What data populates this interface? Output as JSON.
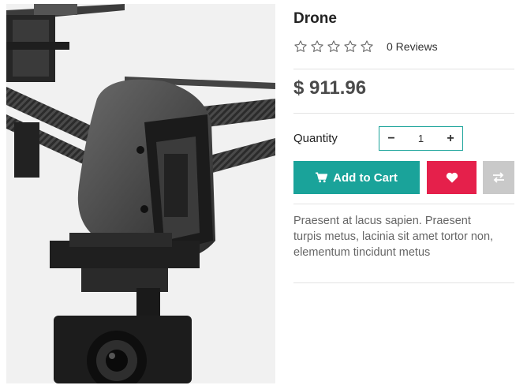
{
  "product": {
    "title": "Drone",
    "image_alt": "drone-image",
    "rating": {
      "stars_filled": 0,
      "stars_total": 5
    },
    "reviews_label": "0 Reviews",
    "price": "$ 911.96",
    "quantity_label": "Quantity",
    "quantity_value": "1",
    "minus_label": "−",
    "plus_label": "+",
    "add_to_cart_label": "Add to Cart",
    "description": "Praesent at lacus sapien. Praesent turpis metus, lacinia sit amet tortor non, elementum tincidunt metus"
  },
  "colors": {
    "accent": "#1aa39a",
    "wishlist": "#e5204b",
    "compare": "#c9c9c9"
  },
  "icons": {
    "cart": "shopping-cart-icon",
    "wishlist": "heart-icon",
    "compare": "compare-arrows-icon",
    "star": "star-outline-icon"
  }
}
